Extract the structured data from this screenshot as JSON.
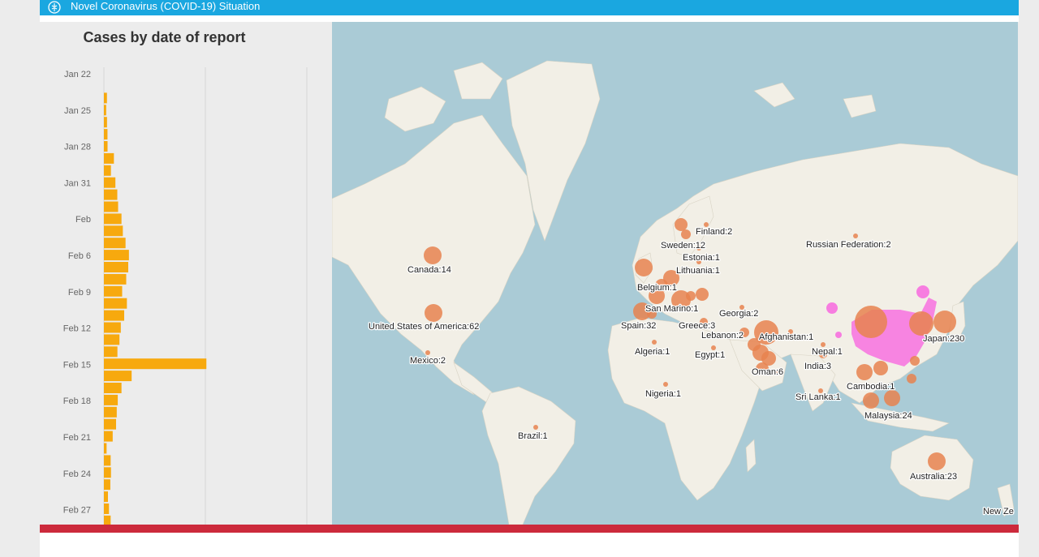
{
  "header": {
    "title": "Novel Coronavirus (COVID-19) Situation",
    "logo_icon": "who-emblem-icon"
  },
  "chart_panel": {
    "title": "Cases by date of report"
  },
  "chart_data": {
    "type": "bar",
    "orientation": "horizontal",
    "title": "Cases by date of report",
    "tick_labels": [
      "Jan 22",
      "Jan 25",
      "Jan 28",
      "Jan 31",
      "Feb",
      "Feb 6",
      "Feb 9",
      "Feb 12",
      "Feb 15",
      "Feb 18",
      "Feb 21",
      "Feb 24",
      "Feb 27"
    ],
    "categories": [
      "Jan 22",
      "Jan 23",
      "Jan 24",
      "Jan 25",
      "Jan 26",
      "Jan 27",
      "Jan 28",
      "Jan 29",
      "Jan 30",
      "Jan 31",
      "Feb 1",
      "Feb 2",
      "Feb 3",
      "Feb 4",
      "Feb 5",
      "Feb 6",
      "Feb 7",
      "Feb 8",
      "Feb 9",
      "Feb 10",
      "Feb 11",
      "Feb 12",
      "Feb 13",
      "Feb 14",
      "Feb 15",
      "Feb 16",
      "Feb 17",
      "Feb 18",
      "Feb 19",
      "Feb 20",
      "Feb 21",
      "Feb 22",
      "Feb 23",
      "Feb 24",
      "Feb 25",
      "Feb 26",
      "Feb 27"
    ],
    "values": [
      0,
      450,
      340,
      460,
      530,
      540,
      1480,
      1040,
      1700,
      1980,
      2100,
      2600,
      2800,
      3200,
      3700,
      3600,
      3300,
      2700,
      3400,
      3000,
      2500,
      2300,
      2000,
      15150,
      4100,
      2600,
      2050,
      1900,
      1800,
      1300,
      400,
      1000,
      1050,
      950,
      600,
      750,
      1000,
      1400
    ],
    "xlim": [
      0,
      30000
    ],
    "grid": true,
    "bar_color": "#f7a90e"
  },
  "map": {
    "colors": {
      "water": "#aacbd6",
      "land": "#f2efe6",
      "country_circle": "#e8834f",
      "china_region": "#f77de0"
    },
    "labels": [
      {
        "name": "Canada:14"
      },
      {
        "name": "United States of America:62"
      },
      {
        "name": "Mexico:2"
      },
      {
        "name": "Brazil:1"
      },
      {
        "name": "Finland:2"
      },
      {
        "name": "Sweden:12"
      },
      {
        "name": "Estonia:1"
      },
      {
        "name": "Lithuania:1"
      },
      {
        "name": "Belgium:1"
      },
      {
        "name": "San Marino:1"
      },
      {
        "name": "Spain:32"
      },
      {
        "name": "Greece:3"
      },
      {
        "name": "Georgia:2"
      },
      {
        "name": "Lebanon:2"
      },
      {
        "name": "Afghanistan:1"
      },
      {
        "name": "Algeria:1"
      },
      {
        "name": "Egypt:1"
      },
      {
        "name": "Nigeria:1"
      },
      {
        "name": "Oman:6"
      },
      {
        "name": "Nepal:1"
      },
      {
        "name": "India:3"
      },
      {
        "name": "Sri Lanka:1"
      },
      {
        "name": "Cambodia:1"
      },
      {
        "name": "Malaysia:24"
      },
      {
        "name": "Japan:230"
      },
      {
        "name": "Russian Federation:2"
      },
      {
        "name": "Australia:23"
      },
      {
        "name": "New Ze"
      }
    ]
  }
}
